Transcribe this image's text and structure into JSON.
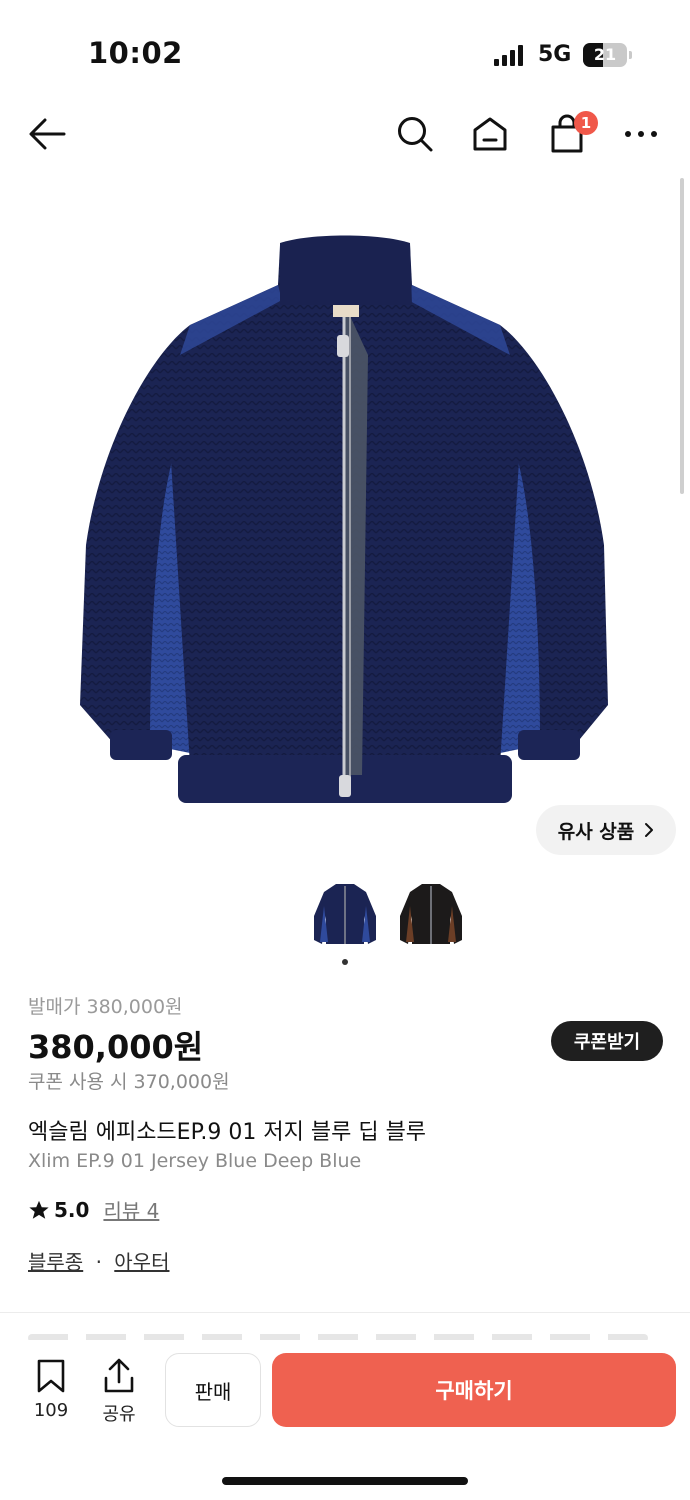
{
  "status_bar": {
    "time": "10:02",
    "network": "5G",
    "battery": "21"
  },
  "nav": {
    "cart_count": "1"
  },
  "hero": {
    "similar_label": "유사 상품"
  },
  "product": {
    "original_price": "발매가 380,000원",
    "price": "380,000원",
    "coupon_price": "쿠폰 사용 시 370,000원",
    "coupon_button": "쿠폰받기",
    "title_ko": "엑슬림 에피소드EP.9 01 저지 블루 딥 블루",
    "title_en": "Xlim EP.9 01 Jersey Blue Deep Blue",
    "rating": "5.0",
    "review_label": "리뷰 4",
    "categories": [
      "블루종",
      "아우터"
    ],
    "category_separator": "·"
  },
  "bottom_bar": {
    "bookmark_count": "109",
    "share_label": "공유",
    "sell_label": "판매",
    "buy_label": "구매하기"
  },
  "colors": {
    "accent": "#ef6150",
    "badge": "#f0584a",
    "jacket": "#1b2453",
    "jacket_panel": "#2f4a9c"
  }
}
